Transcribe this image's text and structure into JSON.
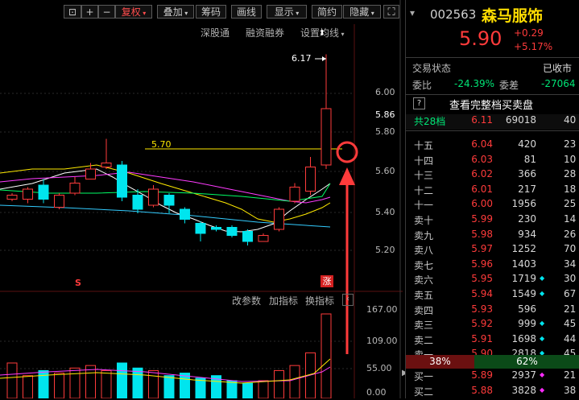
{
  "toolbar": {
    "buttons": [
      "⊡",
      "+",
      "−",
      "复权",
      "叠加",
      "筹码",
      "画线",
      "显示",
      "简约",
      "隐藏"
    ],
    "fullscreen_icon": "fullscreen-icon"
  },
  "sub_links": [
    "深股通",
    "融资融券",
    "设置均线"
  ],
  "price_axis": [
    "6.00",
    "5.86",
    "5.80",
    "5.60",
    "5.40",
    "5.20"
  ],
  "annotations": {
    "high": "6.17",
    "hline": "5.70",
    "limit_badge": "涨",
    "s_marker": "S"
  },
  "indicator_bar": [
    "改参数",
    "加指标",
    "换指标"
  ],
  "volume_axis": [
    "167.00",
    "109.00",
    "55.00",
    "0.00"
  ],
  "chart_data": {
    "type": "candlestick",
    "candles": [
      {
        "o": 5.45,
        "c": 5.47,
        "h": 5.48,
        "l": 5.44
      },
      {
        "o": 5.45,
        "c": 5.5,
        "h": 5.51,
        "l": 5.43
      },
      {
        "o": 5.52,
        "c": 5.45,
        "h": 5.55,
        "l": 5.43
      },
      {
        "o": 5.41,
        "c": 5.47,
        "h": 5.48,
        "l": 5.4
      },
      {
        "o": 5.48,
        "c": 5.53,
        "h": 5.56,
        "l": 5.47
      },
      {
        "o": 5.55,
        "c": 5.6,
        "h": 5.63,
        "l": 5.55
      },
      {
        "o": 5.61,
        "c": 5.63,
        "h": 5.75,
        "l": 5.6
      },
      {
        "o": 5.62,
        "c": 5.46,
        "h": 5.64,
        "l": 5.44
      },
      {
        "o": 5.47,
        "c": 5.4,
        "h": 5.5,
        "l": 5.38
      },
      {
        "o": 5.42,
        "c": 5.5,
        "h": 5.52,
        "l": 5.41
      },
      {
        "o": 5.47,
        "c": 5.42,
        "h": 5.48,
        "l": 5.38
      },
      {
        "o": 5.4,
        "c": 5.35,
        "h": 5.41,
        "l": 5.33
      },
      {
        "o": 5.33,
        "c": 5.28,
        "h": 5.34,
        "l": 5.24
      },
      {
        "o": 5.31,
        "c": 5.3,
        "h": 5.32,
        "l": 5.29
      },
      {
        "o": 5.31,
        "c": 5.27,
        "h": 5.32,
        "l": 5.26
      },
      {
        "o": 5.29,
        "c": 5.24,
        "h": 5.3,
        "l": 5.22
      },
      {
        "o": 5.24,
        "c": 5.27,
        "h": 5.28,
        "l": 5.24
      },
      {
        "o": 5.3,
        "c": 5.4,
        "h": 5.41,
        "l": 5.29
      },
      {
        "o": 5.44,
        "c": 5.51,
        "h": 5.53,
        "l": 5.43
      },
      {
        "o": 5.49,
        "c": 5.61,
        "h": 5.66,
        "l": 5.47
      },
      {
        "o": 5.62,
        "c": 5.9,
        "h": 6.17,
        "l": 5.6
      }
    ],
    "hline": 5.7,
    "ylim": [
      5.12,
      6.2
    ],
    "volume": {
      "values": [
        70,
        45,
        55,
        50,
        60,
        65,
        55,
        70,
        60,
        55,
        45,
        50,
        40,
        45,
        35,
        30,
        35,
        55,
        65,
        90,
        167
      ],
      "up": [
        true,
        true,
        false,
        true,
        true,
        true,
        true,
        false,
        false,
        true,
        false,
        false,
        false,
        false,
        false,
        false,
        true,
        true,
        true,
        true,
        true
      ],
      "ylim": [
        0,
        175
      ]
    }
  },
  "panel": {
    "code": "002563",
    "name": "森马服饰",
    "price": "5.90",
    "change": "+0.29",
    "change_pct": "+5.17%",
    "status_label": "交易状态",
    "status_value": "已收市",
    "weibi_label": "委比",
    "weibi_value": "-24.39%",
    "weicha_label": "委差",
    "weicha_value": "-27064",
    "full_book_label": "查看完整档买卖盘",
    "total_label": "共28档",
    "total_price": "6.11",
    "total_qty": "69018",
    "total_ext": "40",
    "asks": [
      {
        "label": "十五",
        "price": "6.04",
        "qty": "420",
        "dot": "",
        "ext": "23"
      },
      {
        "label": "十四",
        "price": "6.03",
        "qty": "81",
        "dot": "",
        "ext": "10"
      },
      {
        "label": "十三",
        "price": "6.02",
        "qty": "366",
        "dot": "",
        "ext": "28"
      },
      {
        "label": "十二",
        "price": "6.01",
        "qty": "217",
        "dot": "",
        "ext": "18"
      },
      {
        "label": "十一",
        "price": "6.00",
        "qty": "1956",
        "dot": "",
        "ext": "25"
      },
      {
        "label": "卖十",
        "price": "5.99",
        "qty": "230",
        "dot": "",
        "ext": "14"
      },
      {
        "label": "卖九",
        "price": "5.98",
        "qty": "934",
        "dot": "",
        "ext": "26"
      },
      {
        "label": "卖八",
        "price": "5.97",
        "qty": "1252",
        "dot": "",
        "ext": "70"
      },
      {
        "label": "卖七",
        "price": "5.96",
        "qty": "1403",
        "dot": "",
        "ext": "34"
      },
      {
        "label": "卖六",
        "price": "5.95",
        "qty": "1719",
        "dot": "◆",
        "ext": "30"
      },
      {
        "label": "卖五",
        "price": "5.94",
        "qty": "1549",
        "dot": "◆",
        "ext": "67"
      },
      {
        "label": "卖四",
        "price": "5.93",
        "qty": "596",
        "dot": "",
        "ext": "21"
      },
      {
        "label": "卖三",
        "price": "5.92",
        "qty": "999",
        "dot": "◆",
        "ext": "45"
      },
      {
        "label": "卖二",
        "price": "5.91",
        "qty": "1698",
        "dot": "◆",
        "ext": "44"
      },
      {
        "label": "卖一",
        "price": "5.90",
        "qty": "2818",
        "dot": "◆",
        "ext": "45"
      }
    ],
    "ratio_sell": "38%",
    "ratio_buy": "62%",
    "bids": [
      {
        "label": "买一",
        "price": "5.89",
        "qty": "2937",
        "dot": "◆",
        "ext": "21"
      },
      {
        "label": "买二",
        "price": "5.88",
        "qty": "3828",
        "dot": "◆",
        "ext": "38"
      }
    ]
  },
  "colors": {
    "up": "#ff3b3b",
    "down": "#00e5ee",
    "ask_dot": "#00e5ee",
    "bid_dot": "#ff2bff",
    "name": "#ffdd00"
  }
}
